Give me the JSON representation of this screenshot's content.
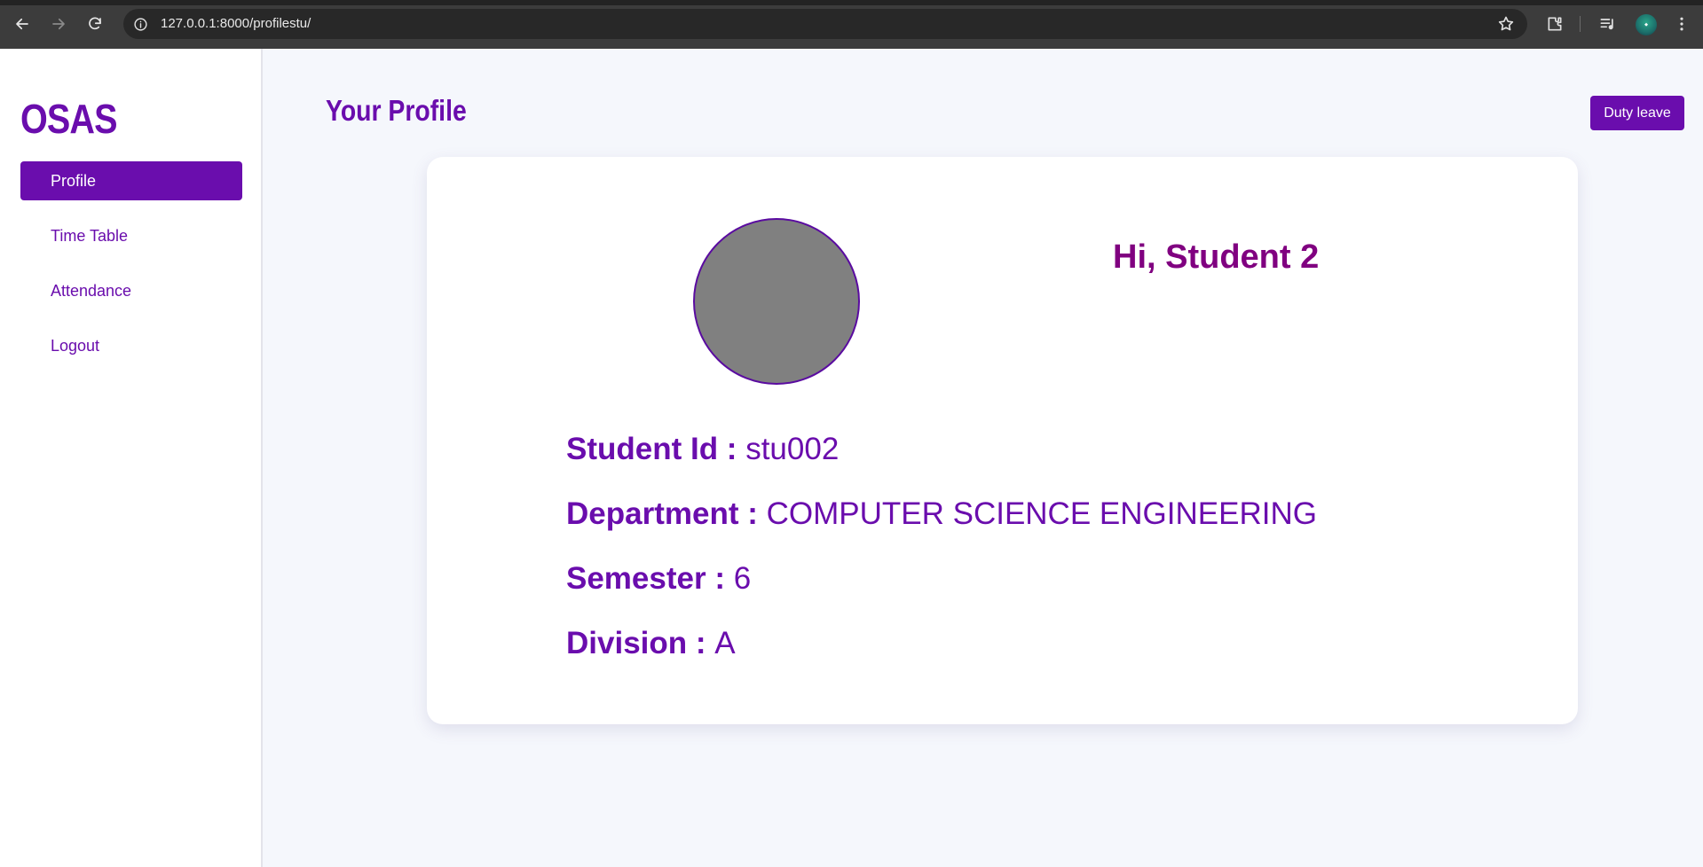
{
  "browser": {
    "url": "127.0.0.1:8000/profilestu/",
    "icons": [
      "back-icon",
      "forward-icon",
      "reload-icon",
      "info-icon",
      "star-icon",
      "extensions-icon",
      "media-icon",
      "profile-avatar",
      "more-icon"
    ]
  },
  "sidebar": {
    "brand": "OSAS",
    "items": [
      {
        "label": "Profile",
        "active": true
      },
      {
        "label": "Time Table",
        "active": false
      },
      {
        "label": "Attendance",
        "active": false
      },
      {
        "label": "Logout",
        "active": false
      }
    ]
  },
  "header": {
    "title": "Your Profile",
    "duty_leave_label": "Duty leave"
  },
  "profile": {
    "greeting": "Hi, Student 2",
    "fields": [
      {
        "label": "Student Id :",
        "value": "stu002"
      },
      {
        "label": "Department :",
        "value": "COMPUTER SCIENCE ENGINEERING"
      },
      {
        "label": "Semester :",
        "value": "6"
      },
      {
        "label": "Division :",
        "value": "A"
      }
    ]
  },
  "colors": {
    "accent": "#6a0dad",
    "greeting": "#800080",
    "avatar_fill": "#808080",
    "page_bg": "#f5f7fc"
  }
}
